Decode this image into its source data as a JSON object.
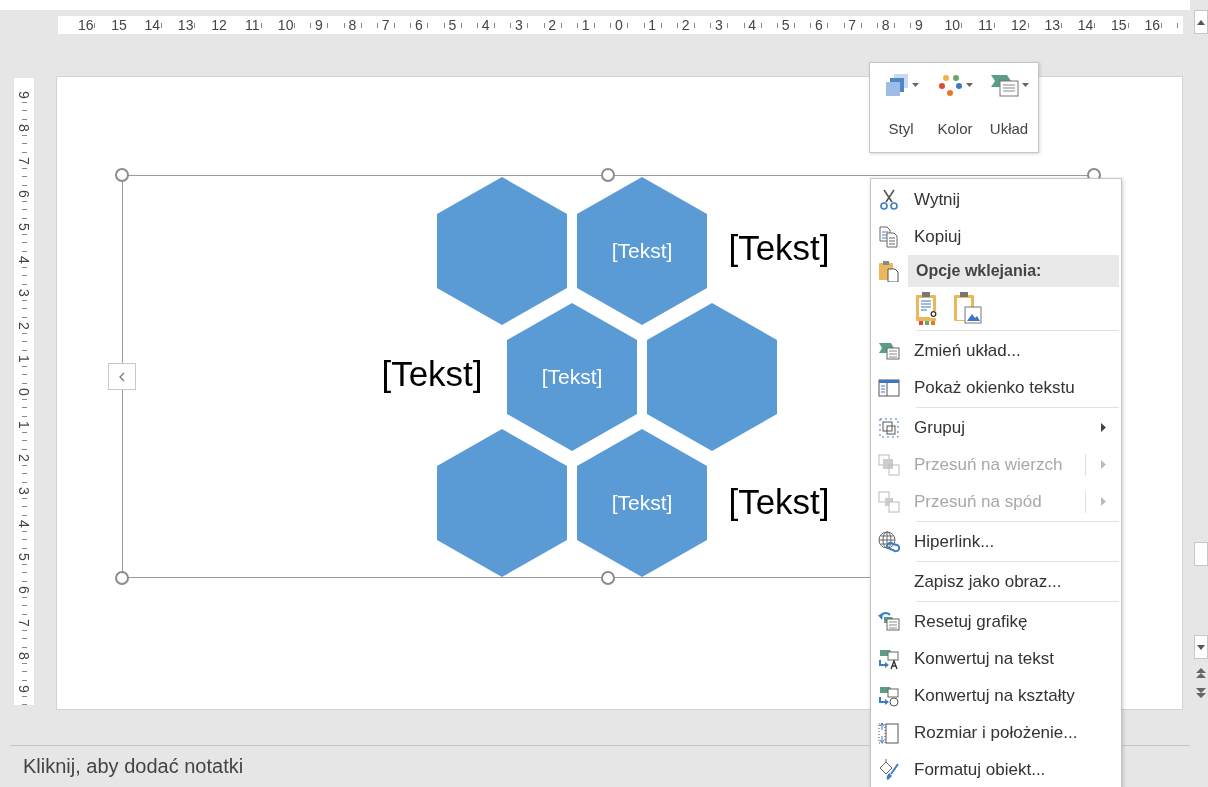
{
  "horizontal_ruler": [
    "16",
    "15",
    "14",
    "13",
    "12",
    "11",
    "10",
    "9",
    "8",
    "7",
    "6",
    "5",
    "4",
    "3",
    "2",
    "1",
    "0",
    "1",
    "2",
    "3",
    "4",
    "5",
    "6",
    "7",
    "8",
    "9",
    "10",
    "11",
    "12",
    "13",
    "14",
    "15",
    "16"
  ],
  "vertical_ruler": [
    "9",
    "8",
    "7",
    "6",
    "5",
    "4",
    "3",
    "2",
    "1",
    "0",
    "1",
    "2",
    "3",
    "4",
    "5",
    "6",
    "7",
    "8",
    "9"
  ],
  "smartart": {
    "hexagons": [
      {
        "kind": "plain"
      },
      {
        "kind": "labeled",
        "text": "[Tekst]"
      },
      {
        "kind": "labeled",
        "text": "[Tekst]"
      },
      {
        "kind": "plain"
      },
      {
        "kind": "plain"
      },
      {
        "kind": "labeled",
        "text": "[Tekst]"
      }
    ],
    "labels": [
      "[Tekst]",
      "[Tekst]",
      "[Tekst]"
    ]
  },
  "mini_toolbar": {
    "buttons": [
      {
        "label": "Styl"
      },
      {
        "label": "Kolor"
      },
      {
        "label": "Układ"
      }
    ]
  },
  "context_menu": {
    "groups": [
      {
        "items": [
          {
            "kind": "command",
            "label": "Wytnij",
            "disabled": false,
            "submenu": false
          },
          {
            "kind": "command",
            "label": "Kopiuj",
            "disabled": false,
            "submenu": false
          },
          {
            "kind": "header",
            "label": "Opcje wklejania:"
          },
          {
            "kind": "paste-options"
          }
        ]
      },
      {
        "items": [
          {
            "kind": "command",
            "label": "Zmień układ...",
            "disabled": false,
            "submenu": false
          },
          {
            "kind": "command",
            "label": "Pokaż okienko tekstu",
            "disabled": false,
            "submenu": false
          }
        ]
      },
      {
        "items": [
          {
            "kind": "command",
            "label": "Grupuj",
            "disabled": false,
            "submenu": true
          },
          {
            "kind": "command",
            "label": "Przesuń na wierzch",
            "disabled": true,
            "submenu": true
          },
          {
            "kind": "command",
            "label": "Przesuń na spód",
            "disabled": true,
            "submenu": true
          }
        ]
      },
      {
        "items": [
          {
            "kind": "command",
            "label": "Hiperlink...",
            "disabled": false,
            "submenu": false
          }
        ]
      },
      {
        "items": [
          {
            "kind": "command",
            "label": "Zapisz jako obraz...",
            "disabled": false,
            "submenu": false
          }
        ]
      },
      {
        "items": [
          {
            "kind": "command",
            "label": "Resetuj grafikę",
            "disabled": false,
            "submenu": false
          },
          {
            "kind": "command",
            "label": "Konwertuj na tekst",
            "disabled": false,
            "submenu": false
          },
          {
            "kind": "command",
            "label": "Konwertuj na kształty",
            "disabled": false,
            "submenu": false
          },
          {
            "kind": "command",
            "label": "Rozmiar i położenie...",
            "disabled": false,
            "submenu": false
          },
          {
            "kind": "command",
            "label": "Formatuj obiekt...",
            "disabled": false,
            "submenu": false
          }
        ]
      }
    ]
  },
  "notes": {
    "placeholder": "Kliknij, aby dodać notatki"
  }
}
